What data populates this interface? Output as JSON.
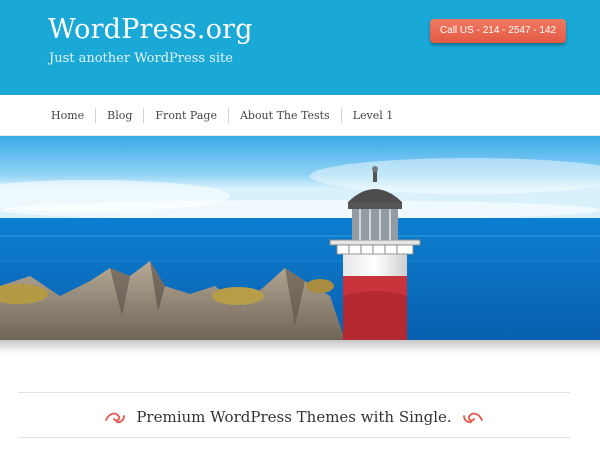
{
  "header": {
    "site_title": "WordPress.org",
    "tagline": "Just another WordPress site",
    "call_button": "Call US - 214 - 2547 - 142"
  },
  "nav": {
    "items": [
      {
        "label": "Home"
      },
      {
        "label": "Blog"
      },
      {
        "label": "Front Page"
      },
      {
        "label": "About The Tests"
      },
      {
        "label": "Level 1"
      }
    ]
  },
  "banner": {
    "text": "Premium WordPress Themes with Single."
  },
  "colors": {
    "header_bg": "#1aa8d6",
    "button_bg": "#e8604a",
    "ornament": "#e2574c"
  },
  "icons": {
    "left_ornament": "swirl-ornament-icon",
    "right_ornament": "swirl-ornament-icon"
  }
}
